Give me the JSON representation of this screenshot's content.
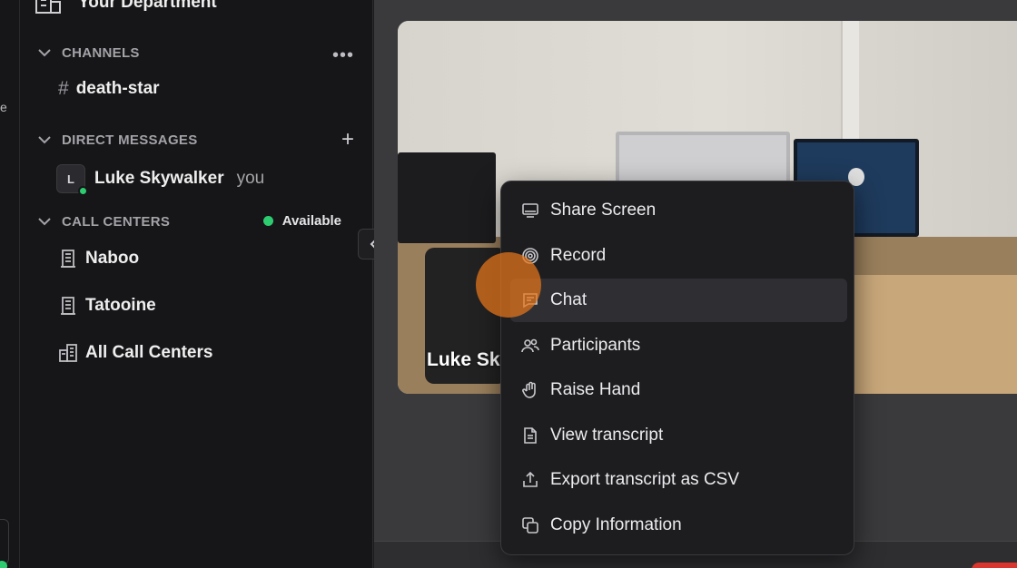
{
  "left_rail": {
    "fragment": "e"
  },
  "sidebar": {
    "department": "Your Department",
    "channels": {
      "header": "CHANNELS",
      "items": [
        {
          "label": "death-star"
        }
      ]
    },
    "direct_messages": {
      "header": "DIRECT MESSAGES",
      "items": [
        {
          "initial": "L",
          "name": "Luke Skywalker",
          "suffix": "you"
        }
      ]
    },
    "call_centers": {
      "header": "CALL CENTERS",
      "status": "Available",
      "items": [
        {
          "label": "Naboo"
        },
        {
          "label": "Tatooine"
        },
        {
          "label": "All Call Centers"
        }
      ]
    }
  },
  "video": {
    "participant_label": "Luke Sky"
  },
  "context_menu": {
    "items": [
      {
        "label": "Share Screen",
        "icon": "monitor-icon"
      },
      {
        "label": "Record",
        "icon": "record-icon"
      },
      {
        "label": "Chat",
        "icon": "chat-icon"
      },
      {
        "label": "Participants",
        "icon": "participants-icon"
      },
      {
        "label": "Raise Hand",
        "icon": "hand-icon"
      },
      {
        "label": "View transcript",
        "icon": "document-icon"
      },
      {
        "label": "Export transcript as CSV",
        "icon": "export-icon"
      },
      {
        "label": "Copy Information",
        "icon": "copy-icon"
      }
    ],
    "active_item": "Chat"
  },
  "colors": {
    "available": "#2ecc71",
    "cursor": "#e8761a",
    "end_call": "#d9362f"
  }
}
